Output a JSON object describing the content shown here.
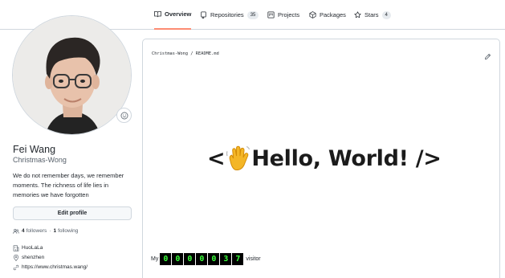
{
  "tabs": [
    {
      "label": "Overview",
      "icon": "book-icon",
      "active": true
    },
    {
      "label": "Repositories",
      "icon": "repo-icon",
      "count": "35"
    },
    {
      "label": "Projects",
      "icon": "project-icon"
    },
    {
      "label": "Packages",
      "icon": "package-icon"
    },
    {
      "label": "Stars",
      "icon": "star-icon",
      "count": "4"
    }
  ],
  "profile": {
    "full_name": "Fei Wang",
    "username": "Christmas-Wong",
    "bio": "We do not remember days, we remember moments. The richness of life lies in memories we have forgotten",
    "edit_label": "Edit profile",
    "followers_count": "4",
    "followers_label": "followers",
    "following_count": "1",
    "following_label": "following",
    "company": "HuoLaLa",
    "location": "shenzhen",
    "website": "https://www.christmas.wang/"
  },
  "readme": {
    "path": "Christmas-Wong / README.md",
    "heading_left": "<",
    "heading_right": "Hello, World! />",
    "counter_prefix": "My",
    "counter_digits": [
      "0",
      "0",
      "0",
      "0",
      "0",
      "3",
      "7"
    ],
    "counter_suffix": "visitor"
  },
  "colors": {
    "active_tab_underline": "#fd8c73",
    "counter_digit": "#3cff3c",
    "border": "#d0d7de"
  }
}
